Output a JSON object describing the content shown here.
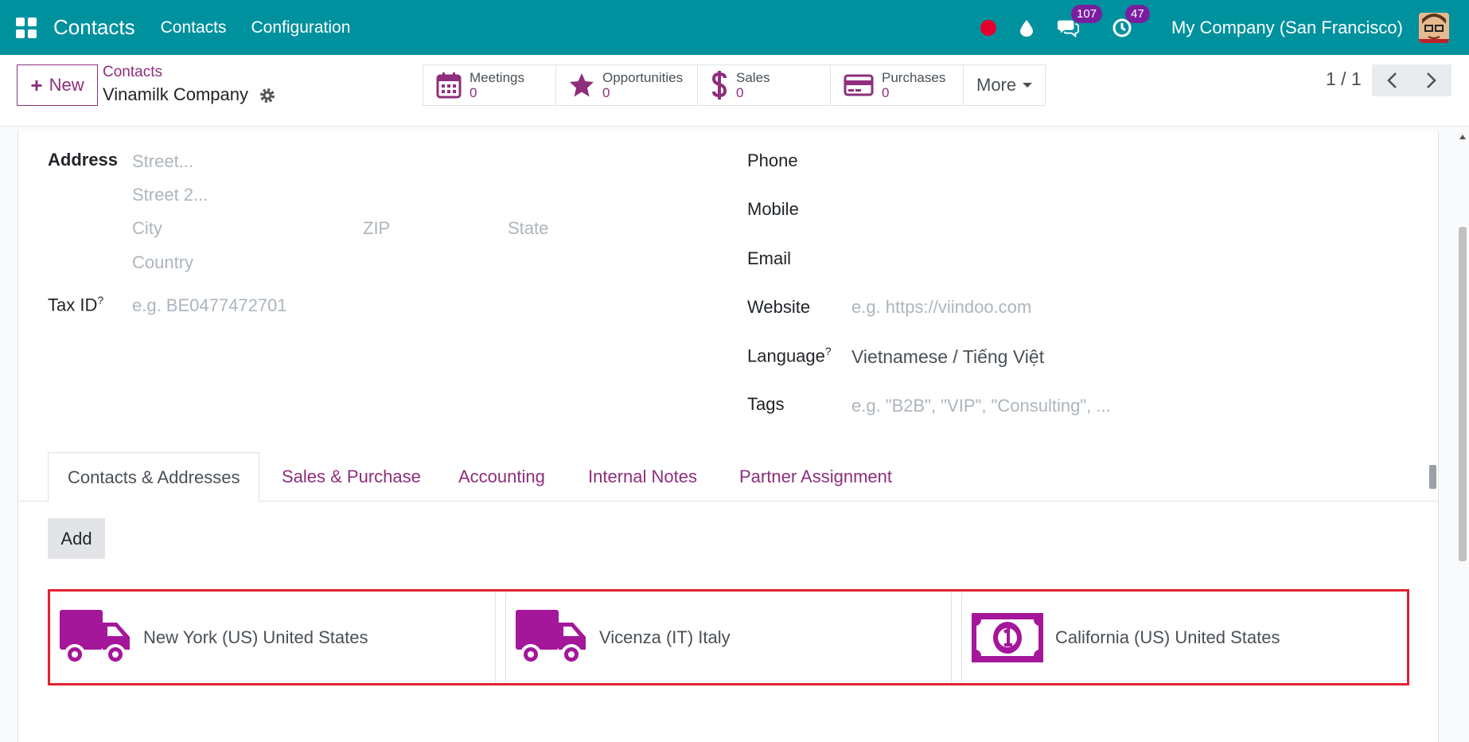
{
  "topbar": {
    "app_title": "Contacts",
    "menu": [
      "Contacts",
      "Configuration"
    ],
    "chat_count": "107",
    "activity_count": "47",
    "company": "My Company (San Francisco)"
  },
  "control": {
    "new_label": "New",
    "breadcrumb": "Contacts",
    "record_name": "Vinamilk Company",
    "smart_buttons": [
      {
        "label": "Meetings",
        "value": "0",
        "icon": "calendar-icon"
      },
      {
        "label": "Opportunities",
        "value": "0",
        "icon": "star-icon"
      },
      {
        "label": "Sales",
        "value": "0",
        "icon": "dollar-icon"
      },
      {
        "label": "Purchases",
        "value": "0",
        "icon": "credit-card-icon"
      }
    ],
    "more_label": "More",
    "pager": "1 / 1"
  },
  "form": {
    "address_label": "Address",
    "street_ph": "Street...",
    "street2_ph": "Street 2...",
    "city_ph": "City",
    "zip_ph": "ZIP",
    "state_ph": "State",
    "country_ph": "Country",
    "taxid_label": "Tax ID",
    "taxid_ph": "e.g. BE0477472701",
    "phone_label": "Phone",
    "mobile_label": "Mobile",
    "email_label": "Email",
    "website_label": "Website",
    "website_ph": "e.g. https://viindoo.com",
    "language_label": "Language",
    "language_value": "Vietnamese / Tiếng Việt",
    "tags_label": "Tags",
    "tags_ph": "e.g. \"B2B\", \"VIP\", \"Consulting\", ...",
    "help_mark": "?"
  },
  "tabs": [
    "Contacts & Addresses",
    "Sales & Purchase",
    "Accounting",
    "Internal Notes",
    "Partner Assignment"
  ],
  "add_label": "Add",
  "address_cards": [
    {
      "name": "New York (US) United States",
      "icon": "delivery-truck-icon"
    },
    {
      "name": "Vicenza (IT) Italy",
      "icon": "delivery-truck-icon"
    },
    {
      "name": "California (US) United States",
      "icon": "invoice-money-icon"
    }
  ],
  "colors": {
    "brand": "#00919e",
    "accent": "#8e2e7c",
    "icon": "#a4169a",
    "highlight": "#e2222e"
  }
}
